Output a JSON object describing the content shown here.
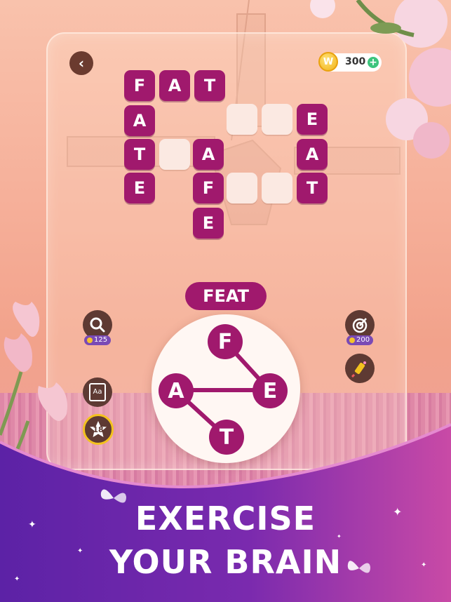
{
  "header": {
    "back_icon": "chevron-left-icon",
    "coins": {
      "value": "300",
      "coin_letter": "W",
      "plus": "+"
    }
  },
  "board": {
    "rows": [
      [
        "F",
        "A",
        "T"
      ],
      [
        "A"
      ],
      [
        "T"
      ],
      [
        "E"
      ]
    ],
    "tiles": [
      {
        "id": "r0c0",
        "letter": "F"
      },
      {
        "id": "r0c1",
        "letter": "A"
      },
      {
        "id": "r0c2",
        "letter": "T"
      },
      {
        "id": "c0r1",
        "letter": "A"
      },
      {
        "id": "c0r2",
        "letter": "T"
      },
      {
        "id": "c0r3",
        "letter": "E"
      },
      {
        "id": "m1",
        "letter": "A"
      },
      {
        "id": "m2",
        "letter": "F"
      },
      {
        "id": "m3",
        "letter": "E"
      },
      {
        "id": "e1",
        "letter": "E"
      },
      {
        "id": "e2",
        "letter": "A"
      },
      {
        "id": "e3",
        "letter": "T"
      }
    ]
  },
  "current_word": "FEAT",
  "wheel": {
    "letters": [
      "F",
      "E",
      "T",
      "A"
    ]
  },
  "tools": {
    "hint": {
      "icon": "magnifier-icon",
      "cost": "125"
    },
    "target": {
      "icon": "target-icon",
      "cost": "200"
    },
    "dictionary": {
      "icon": "dictionary-icon",
      "label": "Aa"
    },
    "rocket": {
      "icon": "firework-rocket-icon"
    },
    "level_star": {
      "icon": "star-icon",
      "value": "18"
    }
  },
  "headline": {
    "line1": "EXERCISE",
    "line2": "YOUR BRAIN"
  },
  "colors": {
    "tile": "#a0196d",
    "purple": "#6a2aa8",
    "pink": "#c94aa6"
  }
}
